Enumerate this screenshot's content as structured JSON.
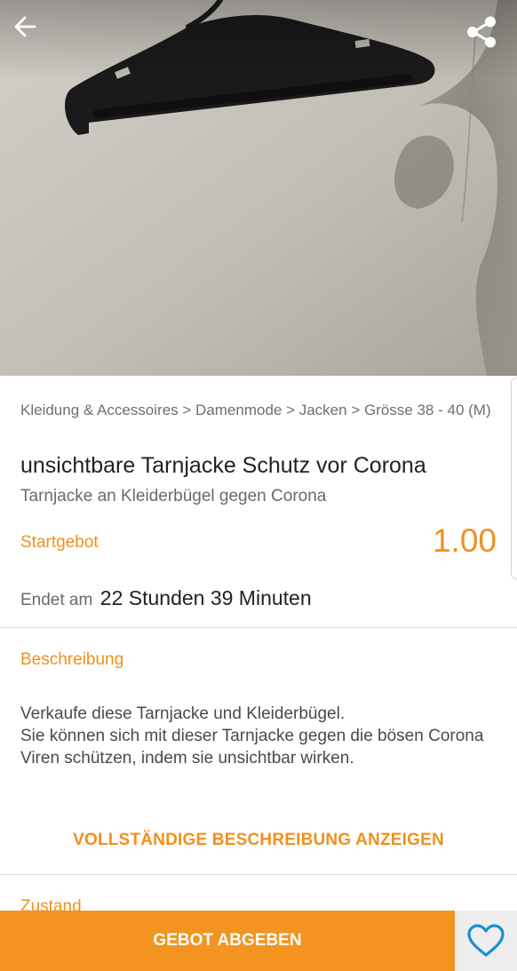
{
  "hero": {
    "image": "clothes-hanger-photo",
    "back_icon": "arrow-left-icon",
    "share_icon": "share-icon"
  },
  "listing": {
    "breadcrumb": "Kleidung & Accessoires > Damenmode > Jacken > Grösse 38 - 40 (M)",
    "title": "unsichtbare Tarnjacke Schutz vor Corona",
    "subtitle": "Tarnjacke an Kleiderbügel gegen Corona",
    "price_label": "Startgebot",
    "price_value": "1.00",
    "ends_label": "Endet am",
    "ends_value": "22 Stunden 39 Minuten"
  },
  "description": {
    "heading": "Beschreibung",
    "text": "Verkaufe diese Tarnjacke und Kleiderbügel.\nSie können sich mit dieser Tarnjacke gegen die bösen Corona Viren schützen, indem sie unsichtbar wirken.",
    "more_label": "VOLLSTÄNDIGE BESCHREIBUNG ANZEIGEN"
  },
  "condition": {
    "heading": "Zustand"
  },
  "bottom_bar": {
    "bid_label": "GEBOT ABGEBEN",
    "favorite_icon": "heart-outline-icon"
  },
  "colors": {
    "accent": "#f0901e",
    "button": "#f39420",
    "heart": "#1a8fd0"
  }
}
